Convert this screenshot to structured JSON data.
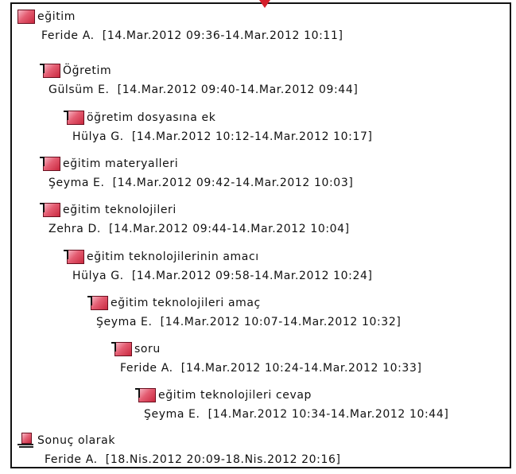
{
  "thread": {
    "posts": [
      {
        "title": "eğitim",
        "author": "Feride A.",
        "timespan": "[14.Mar.2012 09:36-14.Mar.2012 10:11]"
      },
      {
        "title": "Öğretim",
        "author": "Gülsüm E.",
        "timespan": "[14.Mar.2012 09:40-14.Mar.2012 09:44]"
      },
      {
        "title": "öğretim dosyasına ek",
        "author": "Hülya G.",
        "timespan": "[14.Mar.2012 10:12-14.Mar.2012 10:17]"
      },
      {
        "title": "eğitim materyalleri",
        "author": "Şeyma E.",
        "timespan": "[14.Mar.2012 09:42-14.Mar.2012 10:03]"
      },
      {
        "title": "eğitim teknolojileri",
        "author": "Zehra D.",
        "timespan": "[14.Mar.2012 09:44-14.Mar.2012 10:04]"
      },
      {
        "title": "eğitim teknolojilerinin amacı",
        "author": "Hülya G.",
        "timespan": "[14.Mar.2012 09:58-14.Mar.2012 10:24]"
      },
      {
        "title": "eğitim teknolojileri amaç",
        "author": "Şeyma E.",
        "timespan": "[14.Mar.2012 10:07-14.Mar.2012 10:32]"
      },
      {
        "title": "soru",
        "author": "Feride A.",
        "timespan": "[14.Mar.2012 10:24-14.Mar.2012 10:33]"
      },
      {
        "title": "eğitim teknolojileri cevap",
        "author": "Şeyma E.",
        "timespan": "[14.Mar.2012 10:34-14.Mar.2012 10:44]"
      },
      {
        "title": "Sonuç olarak",
        "author": "Feride A.",
        "timespan": "[18.Nis.2012 20:09-18.Nis.2012 20:16]"
      }
    ]
  },
  "icons": {
    "message": "message-icon",
    "reply": "reply-message-icon",
    "summary": "summary-note-icon"
  },
  "colors": {
    "icon_fill": "#e45d72",
    "top_marker": "#d41f2b"
  }
}
